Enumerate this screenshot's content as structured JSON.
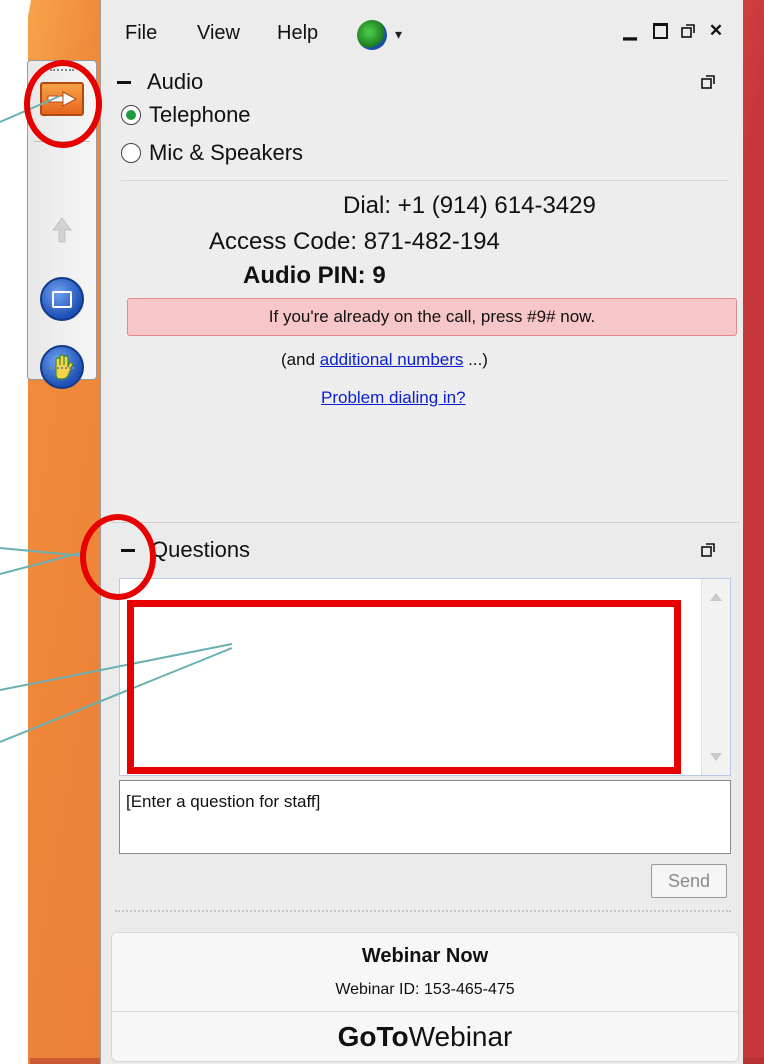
{
  "menu": {
    "file": "File",
    "view": "View",
    "help": "Help",
    "language_icon": "globe-icon"
  },
  "window_controls": [
    "minimize-icon",
    "maximize-icon",
    "restore-icon",
    "close-icon"
  ],
  "audio": {
    "title": "Audio",
    "telephone_label": "Telephone",
    "mic_label": "Mic & Speakers",
    "selected": "Telephone",
    "dial": "Dial: +1 (914) 614-3429",
    "access_code": "Access Code: 871-482-194",
    "audio_pin": "Audio PIN: 9",
    "notice": "If you're already on the call, press #9# now.",
    "additional_prefix": "(and ",
    "additional_link": "additional numbers",
    "additional_suffix": " ...)",
    "problem_link": "Problem dialing in?"
  },
  "questions": {
    "title": "Questions",
    "input_placeholder": "[Enter a question for staff]",
    "send_label": "Send"
  },
  "footer": {
    "title": "Webinar Now",
    "webinar_id": "Webinar ID: 153-465-475",
    "brand_bold": "GoTo",
    "brand_rest": "Webinar"
  },
  "toolbar": {
    "buttons": [
      "show-hide-arrow-icon",
      "upload-icon",
      "screen-icon",
      "raise-hand-icon"
    ]
  },
  "colors": {
    "notice_bg": "#f7c6c8",
    "annotation": "#e60000",
    "link": "#0b1fd1",
    "radio_selected": "#1f9a3c"
  }
}
